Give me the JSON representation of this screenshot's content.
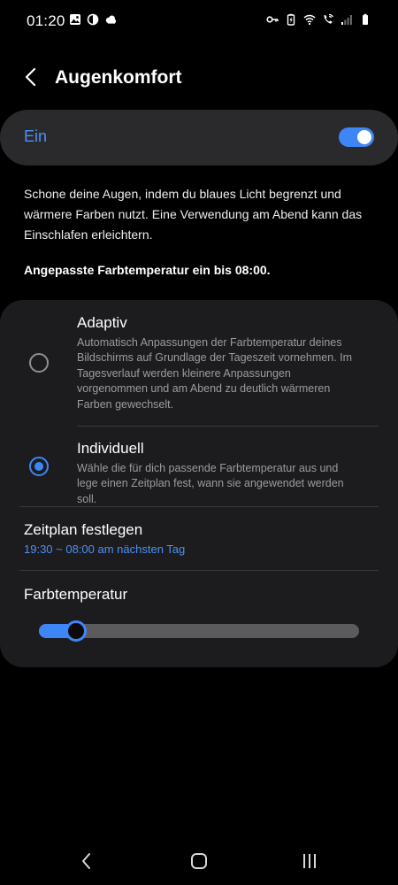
{
  "status_bar": {
    "time": "01:20",
    "left_icons": [
      "gallery-icon",
      "half-circle-icon",
      "cloud-icon"
    ],
    "right_icons": [
      "key-icon",
      "battery-saver-icon",
      "wifi-icon",
      "wifi-call-icon",
      "signal-icon",
      "battery-icon"
    ]
  },
  "header": {
    "back_icon": "chevron-left-icon",
    "title": "Augenkomfort"
  },
  "main_toggle": {
    "label": "Ein",
    "state": "on",
    "accent_color": "#3e86f5"
  },
  "description": "Schone deine Augen, indem du blaues Licht begrenzt und wärmere Farben nutzt. Eine Verwendung am Abend kann das Einschlafen erleichtern.",
  "schedule_note": "Angepasste Farbtemperatur ein bis 08:00.",
  "options": [
    {
      "title": "Adaptiv",
      "description": "Automatisch Anpassungen der Farbtemperatur deines Bildschirms auf Grundlage der Tageszeit vornehmen. Im Tagesverlauf werden kleinere Anpassungen vorgenommen und am Abend zu deutlich wärmeren Farben gewechselt.",
      "selected": false
    },
    {
      "title": "Individuell",
      "description": "Wähle die für dich passende Farbtemperatur aus und lege einen Zeitplan fest, wann sie angewendet werden soll.",
      "selected": true
    }
  ],
  "schedule": {
    "title": "Zeitplan festlegen",
    "value": "19:30 ~ 08:00 am nächsten Tag"
  },
  "color_temperature": {
    "title": "Farbtemperatur",
    "level": 0.115
  },
  "nav_bar": {
    "icons": [
      "back-icon",
      "home-icon",
      "recents-icon"
    ]
  }
}
